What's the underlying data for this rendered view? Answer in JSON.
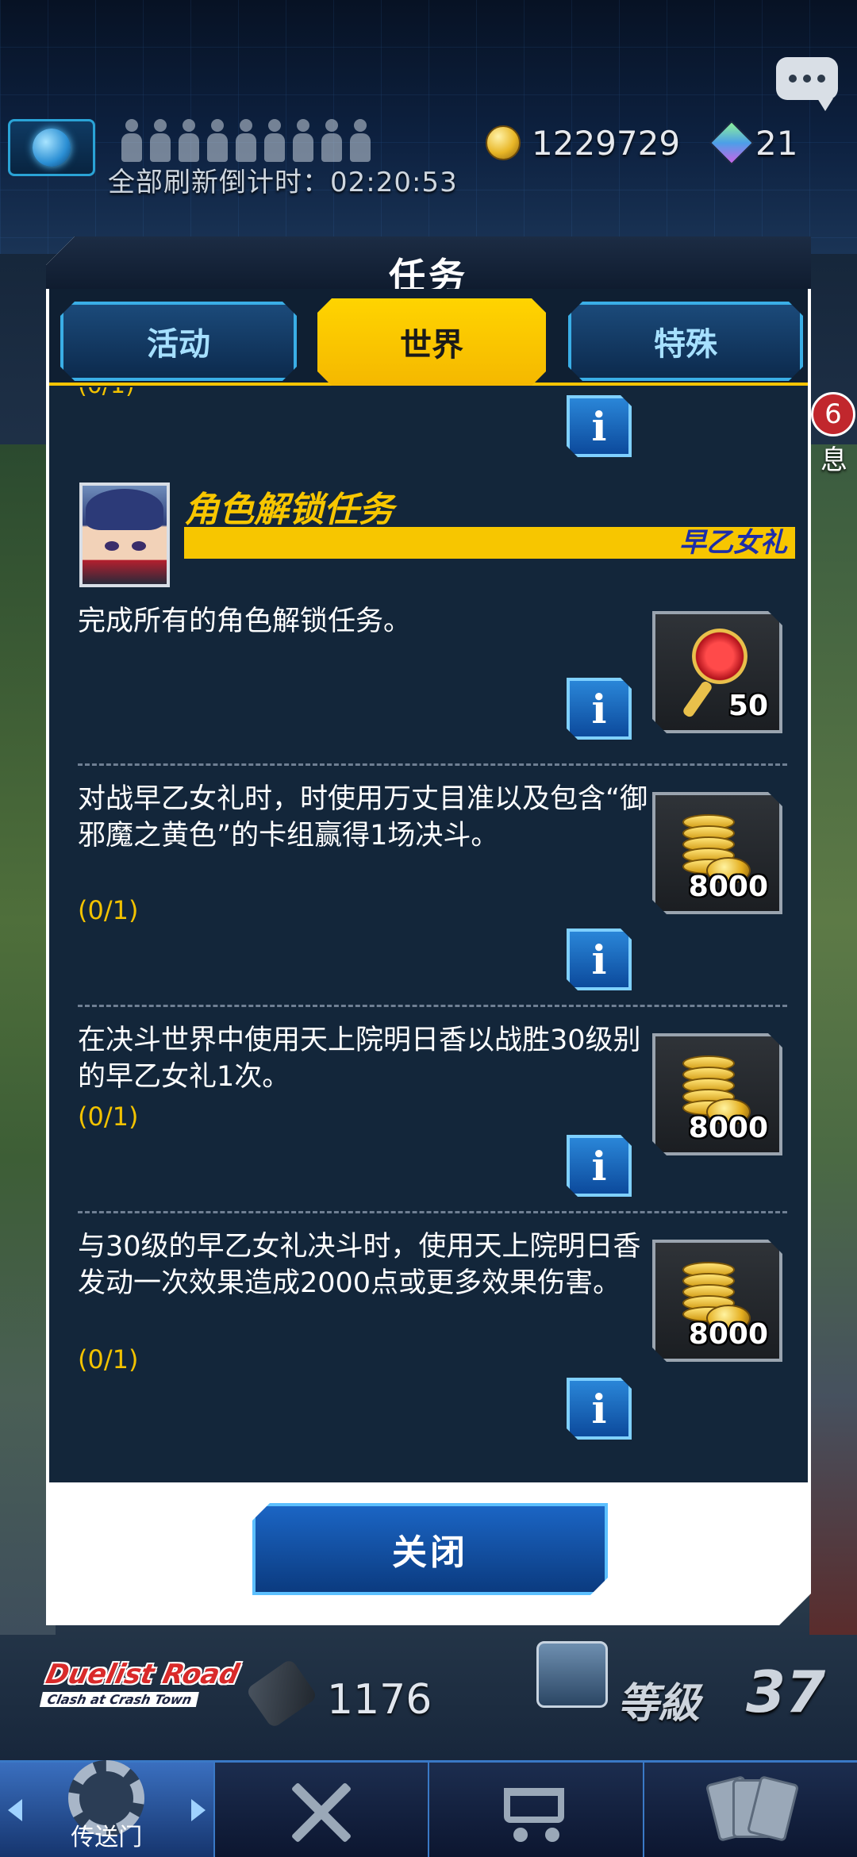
{
  "hud": {
    "refresh_timer": "全部刷新倒计时：02:20:53",
    "coins": "1229729",
    "gems": "21",
    "side_badge": "6",
    "side_label": "息"
  },
  "modal": {
    "title": "任务",
    "tabs": [
      {
        "label": "活动",
        "active": false
      },
      {
        "label": "世界",
        "active": true
      },
      {
        "label": "特殊",
        "active": false
      }
    ],
    "partial_progress": "(0/1)",
    "section": {
      "title": "角色解锁任务",
      "character": "早乙女礼"
    },
    "missions": [
      {
        "text": "完成所有的角色解锁任务。",
        "progress": "",
        "reward_type": "key",
        "reward_count": "50"
      },
      {
        "text": "对战早乙女礼时，时使用万丈目准以及包含“御邪魔之黄色”的卡组赢得1场决斗。",
        "progress": "(0/1)",
        "reward_type": "gold",
        "reward_count": "8000"
      },
      {
        "text": "在决斗世界中使用天上院明日香以战胜30级别的早乙女礼1次。",
        "progress": "(0/1)",
        "reward_type": "gold",
        "reward_count": "8000"
      },
      {
        "text": "与30级的早乙女礼决斗时，使用天上院明日香发动一次效果造成2000点或更多效果伤害。",
        "progress": "(0/1)",
        "reward_type": "gold",
        "reward_count": "8000"
      }
    ],
    "info_glyph": "i",
    "close_label": "关闭"
  },
  "footer": {
    "road_title": "Duelist Road",
    "road_subtitle": "Clash at Crash Town",
    "road_count": "1176",
    "level_label": "等級",
    "level_value": "37",
    "nav": [
      {
        "label": "传送门",
        "icon": "gear-icon"
      },
      {
        "label": "",
        "icon": "crossed-swords-icon"
      },
      {
        "label": "",
        "icon": "shopping-cart-icon"
      },
      {
        "label": "",
        "icon": "cards-icon"
      }
    ]
  }
}
